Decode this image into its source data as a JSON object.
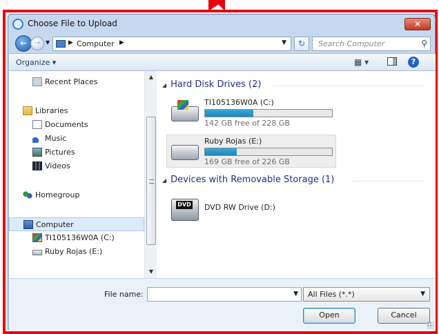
{
  "window": {
    "title": "Choose File to Upload",
    "close_label": "✕"
  },
  "address": {
    "path": [
      "Computer"
    ],
    "search_placeholder": "Search Computer"
  },
  "toolbar": {
    "organize_label": "Organize ▾"
  },
  "nav": {
    "items": [
      {
        "label": "Recent Places",
        "icon": "recent-places-icon"
      },
      {
        "label": "Libraries",
        "icon": "libraries-icon"
      },
      {
        "label": "Documents",
        "icon": "documents-icon"
      },
      {
        "label": "Music",
        "icon": "music-icon"
      },
      {
        "label": "Pictures",
        "icon": "pictures-icon"
      },
      {
        "label": "Videos",
        "icon": "videos-icon"
      },
      {
        "label": "Homegroup",
        "icon": "homegroup-icon"
      },
      {
        "label": "Computer",
        "icon": "computer-icon",
        "selected": true
      },
      {
        "label": "TI105136W0A (C:)",
        "icon": "drive-c-icon"
      },
      {
        "label": "Ruby Rojas (E:)",
        "icon": "drive-e-icon"
      }
    ]
  },
  "groups": {
    "hard_disks": {
      "header": "Hard Disk Drives (2)",
      "drives": [
        {
          "name": "TI105136W0A (C:)",
          "free": "142 GB free of 228 GB",
          "used_fraction": 0.38
        },
        {
          "name": "Ruby Rojas (E:)",
          "free": "169 GB free of 226 GB",
          "used_fraction": 0.25
        }
      ]
    },
    "removable": {
      "header": "Devices with Removable Storage (1)",
      "devices": [
        {
          "name": "DVD RW Drive (D:)",
          "badge": "DVD"
        }
      ]
    }
  },
  "bottom": {
    "file_name_label": "File name:",
    "file_name_value": "",
    "filter_value": "All Files (*.*)",
    "open_label": "Open",
    "cancel_label": "Cancel"
  },
  "colors": {
    "accent_frame": "#e8000f",
    "capacity_fill": "#26a0da",
    "group_header": "#1e3287"
  }
}
